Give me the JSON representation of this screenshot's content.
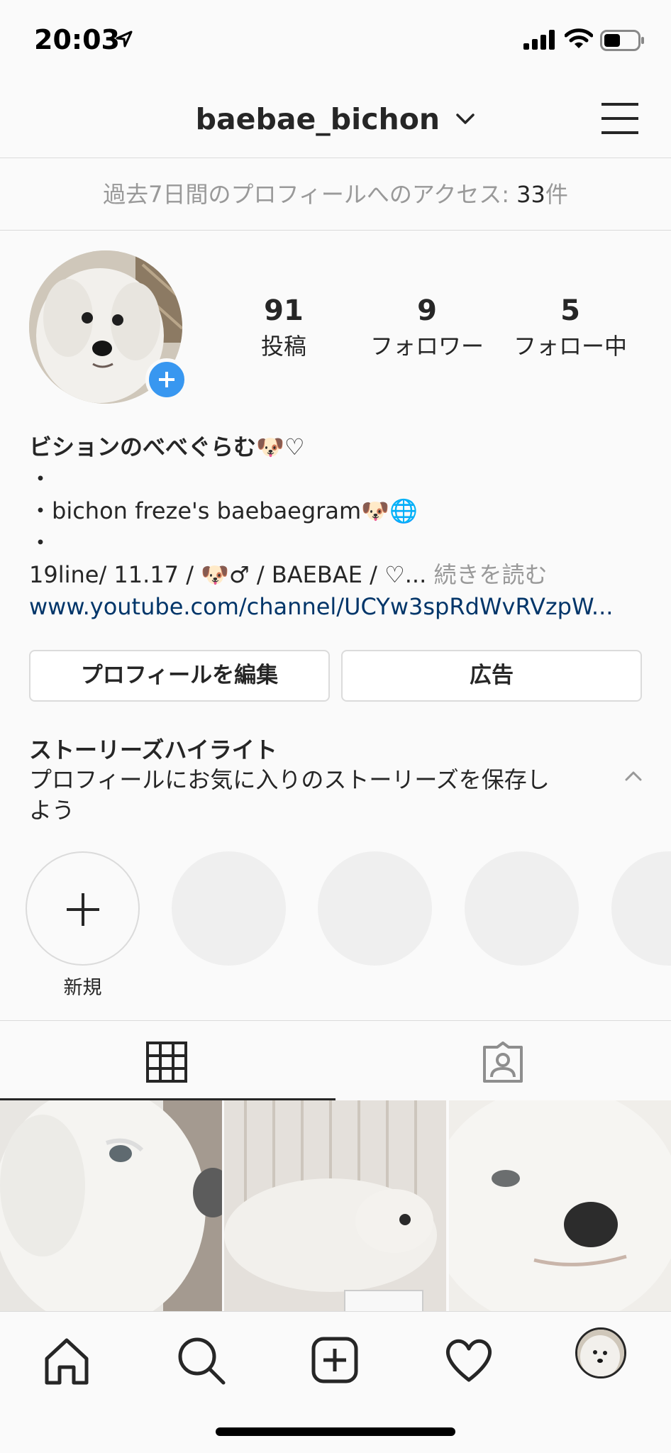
{
  "status_bar": {
    "time": "20:03"
  },
  "header": {
    "username": "baebae_bichon"
  },
  "insights": {
    "label": "過去7日間のプロフィールへのアクセス: ",
    "count": "33",
    "unit": "件"
  },
  "stats": [
    {
      "value": "91",
      "label": "投稿"
    },
    {
      "value": "9",
      "label": "フォロワー"
    },
    {
      "value": "5",
      "label": "フォロー中"
    }
  ],
  "bio": {
    "name": "ビションのべべぐらむ🐶♡",
    "line1": "・",
    "line2": "・bichon freze's baebaegram🐶🌐",
    "line3": "・",
    "line4": "19line/ 11.17 / 🐶♂ / BAEBAE / ♡...",
    "more": " 続きを読む",
    "link": "www.youtube.com/channel/UCYw3spRdWvRVzpW..."
  },
  "buttons": {
    "edit_profile": "プロフィールを編集",
    "ads": "広告"
  },
  "highlights": {
    "title": "ストーリーズハイライト",
    "description": "プロフィールにお気に入りのストーリーズを保存しよう",
    "new_label": "新規"
  },
  "icons": {
    "location": "location-arrow-icon",
    "signal": "cellular-signal-icon",
    "wifi": "wifi-icon",
    "battery": "battery-icon",
    "menu": "hamburger-menu-icon",
    "grid": "grid-icon",
    "tagged": "tagged-person-icon",
    "home": "home-icon",
    "search": "search-icon",
    "new_post": "add-post-icon",
    "activity": "heart-icon"
  },
  "colors": {
    "accent": "#3897f0",
    "link": "#003569",
    "muted": "#999999",
    "border": "#dbdbdb"
  }
}
